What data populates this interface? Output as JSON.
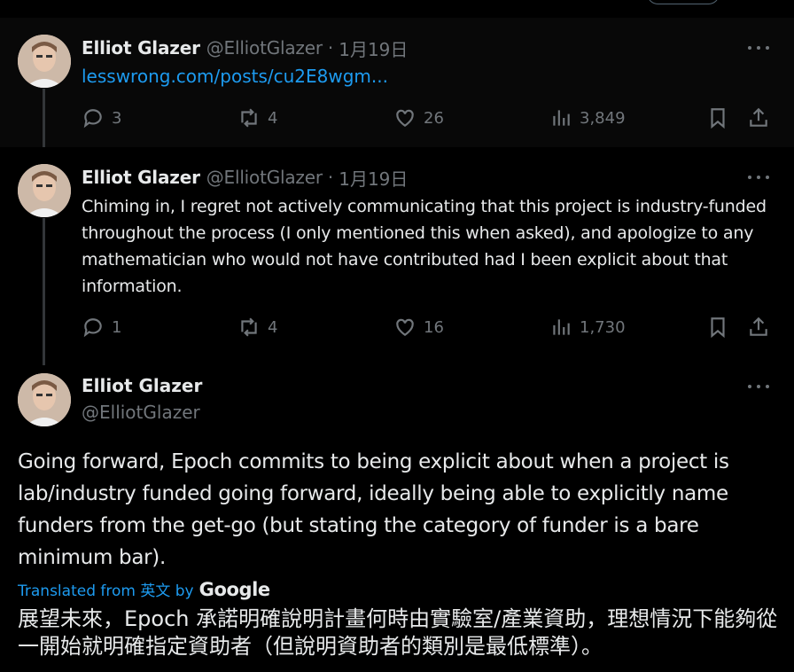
{
  "tweets": [
    {
      "name": "Elliot Glazer",
      "handle": "@ElliotGlazer",
      "sep": "·",
      "date": "1月19日",
      "link": "lesswrong.com/posts/cu2E8wgm...",
      "stats": {
        "replies": "3",
        "reposts": "4",
        "likes": "26",
        "views": "3,849"
      }
    },
    {
      "name": "Elliot Glazer",
      "handle": "@ElliotGlazer",
      "sep": "·",
      "date": "1月19日",
      "text": "Chiming in, I regret not actively communicating that this project is industry-funded throughout the process (I only mentioned this when asked), and apologize to any mathematician who would not have contributed had I been explicit about that information.",
      "stats": {
        "replies": "1",
        "reposts": "4",
        "likes": "16",
        "views": "1,730"
      }
    }
  ],
  "main_tweet": {
    "name": "Elliot Glazer",
    "handle": "@ElliotGlazer",
    "text": "Going forward, Epoch commits to being explicit about when a project is lab/industry funded going forward, ideally being able to explicitly name funders from the get-go (but stating the category of funder is a bare minimum bar).",
    "translated_label": "Translated from 英文 by",
    "google_label": "Google",
    "translation": "展望未來，Epoch 承諾明確說明計畫何時由實驗室/產業資助，理想情況下能夠從一開始就明確指定資助者（但說明資助者的類別是最低標準）。"
  },
  "colors": {
    "accent": "#1d9bf0",
    "muted": "#71767b",
    "text": "#e7e9ea",
    "bg": "#000000"
  },
  "icons": [
    "reply-icon",
    "repost-icon",
    "like-icon",
    "views-icon",
    "bookmark-icon",
    "share-icon",
    "more-icon"
  ]
}
